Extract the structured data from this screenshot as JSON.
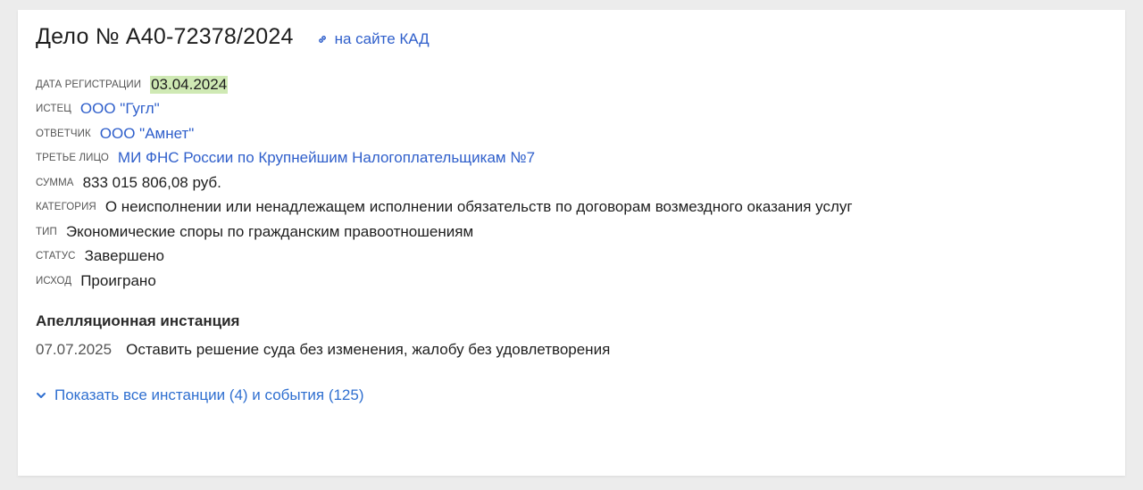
{
  "case": {
    "title": "Дело № А40-72378/2024",
    "kad_link": "на сайте КАД"
  },
  "fields": {
    "registration": {
      "label": "Дата регистрации",
      "value": "03.04.2024"
    },
    "plaintiff": {
      "label": "Истец",
      "value": "ООО \"Гугл\""
    },
    "defendant": {
      "label": "Ответчик",
      "value": "ООО \"Амнет\""
    },
    "third_party": {
      "label": "Третье лицо",
      "value": "МИ ФНС России по Крупнейшим Налогоплательщикам №7"
    },
    "amount": {
      "label": "Сумма",
      "value": "833 015 806,08 руб."
    },
    "category": {
      "label": "Категория",
      "value": "О неисполнении или ненадлежащем исполнении обязательств по договорам возмездного оказания услуг"
    },
    "type": {
      "label": "Тип",
      "value": "Экономические споры по гражданским правоотношениям"
    },
    "status": {
      "label": "Статус",
      "value": "Завершено"
    },
    "outcome": {
      "label": "Исход",
      "value": "Проиграно"
    }
  },
  "appeal": {
    "title": "Апелляционная инстанция",
    "date": "07.07.2025",
    "decision": "Оставить решение суда без изменения, жалобу без удовлетворения"
  },
  "show_all": {
    "label": "Показать все инстанции (4) и события (125)",
    "icon": "chevron-down-icon"
  },
  "colors": {
    "link": "#2f5fcb",
    "date_highlight": "#cfe9b4",
    "background": "#ececec",
    "card": "#ffffff"
  }
}
